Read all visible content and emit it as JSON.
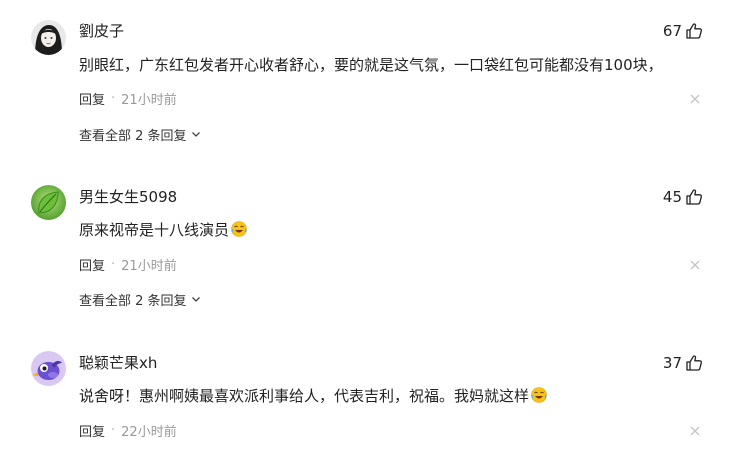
{
  "comments": [
    {
      "username": "劉皮子",
      "likes": "67",
      "text": "别眼红，广东红包发者开心收者舒心，要的就是这气氛，一口袋红包可能都没有100块，",
      "text_emoji": "",
      "reply_label": "回复",
      "time": "21小时前",
      "view_all": "查看全部 2 条回复",
      "avatar_icon": "dark-hair-avatar-icon"
    },
    {
      "username": "男生女生5098",
      "likes": "45",
      "text": "原来视帝是十八线演员",
      "text_emoji": "laughing-crying-emoji-icon",
      "reply_label": "回复",
      "time": "21小时前",
      "view_all": "查看全部 2 条回复",
      "avatar_icon": "green-leaf-avatar-icon"
    },
    {
      "username": "聪颖芒果xh",
      "likes": "37",
      "text": "说舍呀！惠州啊姨最喜欢派利事给人，代表吉利，祝福。我妈就这样",
      "text_emoji": "laughing-crying-emoji-icon",
      "reply_label": "回复",
      "time": "22小时前",
      "view_all": "",
      "avatar_icon": "purple-bird-avatar-icon"
    }
  ],
  "separator": "·",
  "colors": {
    "text": "#222222",
    "meta": "#9a9a9a",
    "background": "#ffffff"
  }
}
